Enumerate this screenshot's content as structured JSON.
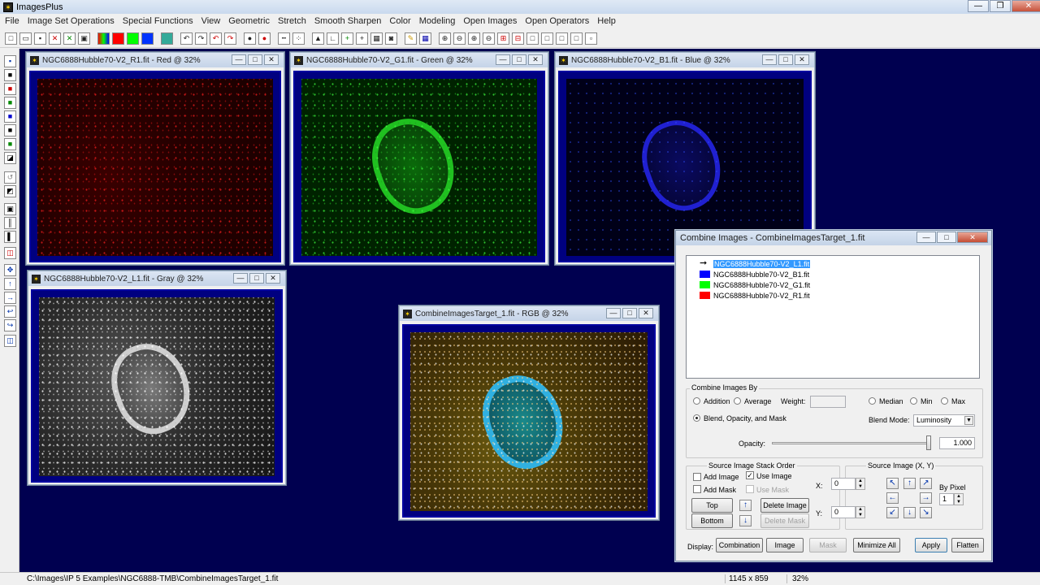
{
  "app": {
    "title": "ImagesPlus"
  },
  "menu": [
    "File",
    "Image Set Operations",
    "Special Functions",
    "View",
    "Geometric",
    "Stretch",
    "Smooth Sharpen",
    "Color",
    "Modeling",
    "Open Images",
    "Open Operators",
    "Help"
  ],
  "windows": {
    "red": {
      "title": "NGC6888Hubble70-V2_R1.fit - Red @ 32%"
    },
    "green": {
      "title": "NGC6888Hubble70-V2_G1.fit - Green @ 32%"
    },
    "blue": {
      "title": "NGC6888Hubble70-V2_B1.fit - Blue @ 32%"
    },
    "gray": {
      "title": "NGC6888Hubble70-V2_L1.fit - Gray @ 32%"
    },
    "rgb": {
      "title": "CombineImagesTarget_1.fit - RGB @ 32%"
    }
  },
  "dialog": {
    "title": "Combine Images - CombineImagesTarget_1.fit",
    "tree": [
      {
        "name": "NGC6888Hubble70-V2_L1.fit",
        "color": "#000000"
      },
      {
        "name": "NGC6888Hubble70-V2_B1.fit",
        "color": "#0000ff"
      },
      {
        "name": "NGC6888Hubble70-V2_G1.fit",
        "color": "#00ff00"
      },
      {
        "name": "NGC6888Hubble70-V2_R1.fit",
        "color": "#ff0000"
      }
    ],
    "combine_by": {
      "label": "Combine Images By",
      "addition": "Addition",
      "average": "Average",
      "weight_label": "Weight:",
      "median": "Median",
      "min": "Min",
      "max": "Max",
      "blend": "Blend, Opacity, and Mask",
      "blend_mode_label": "Blend Mode:",
      "blend_mode_value": "Luminosity",
      "opacity_label": "Opacity:",
      "opacity_value": "1.000",
      "opacity_fraction": 1.0
    },
    "stack_order": {
      "label": "Source Image Stack Order",
      "add_image": "Add Image",
      "use_image": "Use Image",
      "add_mask": "Add Mask",
      "use_mask": "Use Mask",
      "top": "Top",
      "bottom": "Bottom",
      "delete_image": "Delete Image",
      "delete_mask": "Delete Mask"
    },
    "source_xy": {
      "label": "Source Image (X, Y)",
      "x_label": "X:",
      "x_value": "0",
      "y_label": "Y:",
      "y_value": "0",
      "by_pixel_label": "By Pixel",
      "by_pixel_value": "1"
    },
    "display": {
      "label": "Display:",
      "combination": "Combination",
      "image": "Image",
      "mask": "Mask",
      "minimize_all": "Minimize All",
      "apply": "Apply",
      "flatten": "Flatten"
    }
  },
  "status": {
    "path": "C:\\Images\\IP 5 Examples\\NGC6888-TMB\\CombineImagesTarget_1.fit",
    "size": "1145 x 859",
    "zoom": "32%"
  }
}
